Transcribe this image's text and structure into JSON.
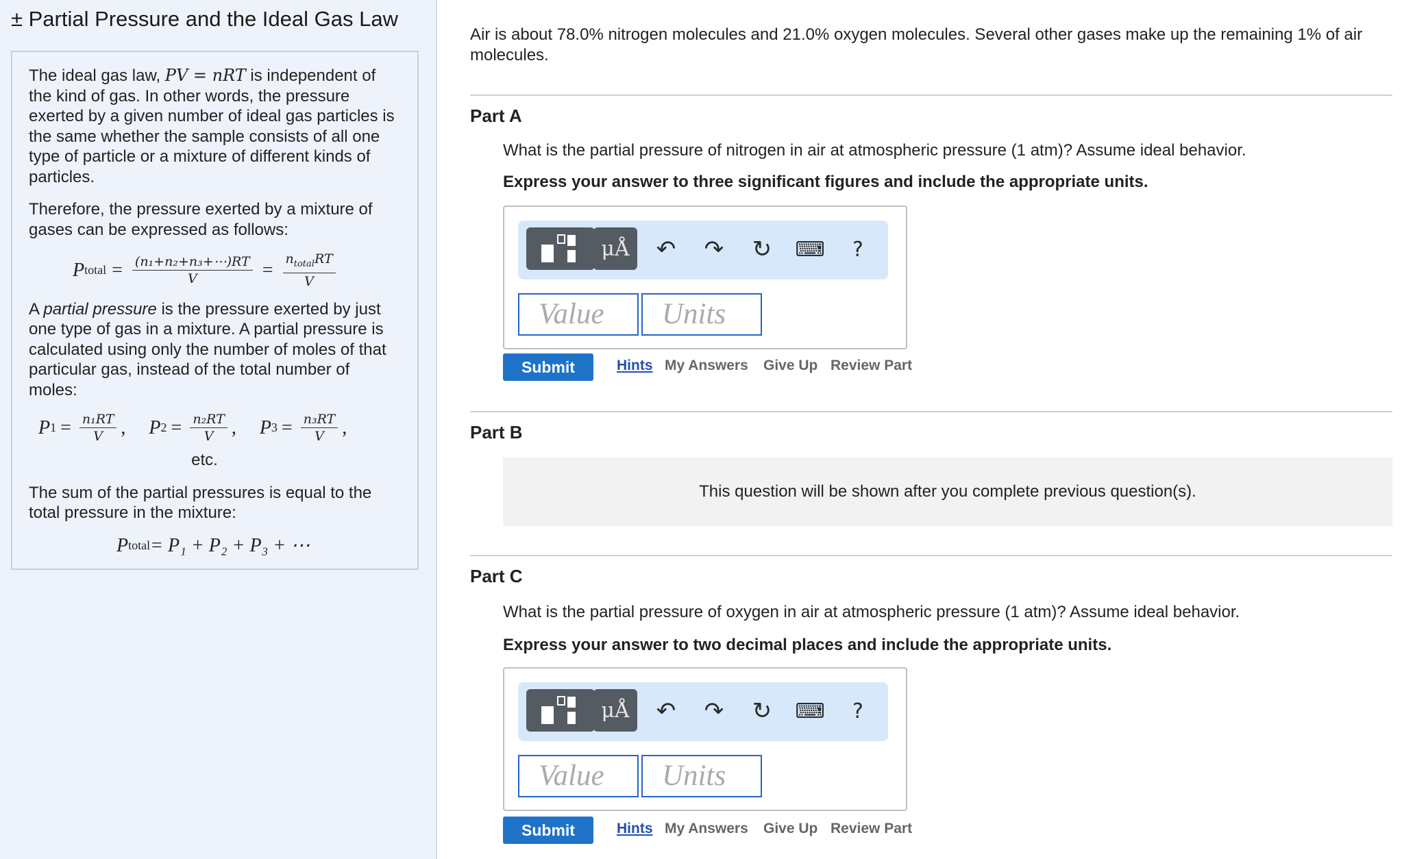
{
  "sidebar": {
    "title": "± Partial Pressure and the Ideal Gas Law",
    "para1_a": "The ideal gas law, ",
    "para1_eq": "PV = nRT",
    "para1_b": " is independent of the kind of gas. In other words, the pressure exerted by a given number of ideal gas particles is the same whether the sample consists of all one type of particle or a mixture of different kinds of particles.",
    "para2": "Therefore, the pressure exerted by a mixture of gases can be expressed as follows:",
    "eq_total": {
      "lhs": "P",
      "lhs_sub": "total",
      "frac1_num": "(n₁+n₂+n₃+⋯)RT",
      "frac1_den": "V",
      "frac2_num": "n",
      "frac2_num_sub": "total",
      "frac2_num_tail": "RT",
      "frac2_den": "V"
    },
    "para3_a": "A ",
    "para3_em": "partial pressure",
    "para3_b": " is the pressure exerted by just one type of gas in a mixture. A partial pressure is calculated using only the number of moles of that particular gas, instead of the total number of moles:",
    "eq_partials": [
      {
        "p": "P",
        "sub": "1",
        "num": "n₁RT",
        "den": "V"
      },
      {
        "p": "P",
        "sub": "2",
        "num": "n₂RT",
        "den": "V"
      },
      {
        "p": "P",
        "sub": "3",
        "num": "n₃RT",
        "den": "V"
      }
    ],
    "etc": "etc.",
    "para4": "The sum of the partial pressures is equal to the total pressure in the mixture:",
    "eq_sum": "P",
    "eq_sum_sub": "total",
    "eq_sum_rhs": " = P₁ + P₂ + P₃ + ⋯"
  },
  "main": {
    "intro": "Air is about 78.0% nitrogen molecules and 21.0% oxygen molecules. Several other gases make up the remaining 1% of air molecules.",
    "part_a": {
      "label": "Part A",
      "question": "What is the partial pressure of nitrogen in air at atmospheric pressure (1 atm)? Assume ideal behavior.",
      "instruction": "Express your answer to three significant figures and include the appropriate units."
    },
    "part_b": {
      "label": "Part B",
      "locked_text": "This question will be shown after you complete previous question(s)."
    },
    "part_c": {
      "label": "Part C",
      "question": "What is the partial pressure of oxygen in air at atmospheric pressure (1 atm)? Assume ideal behavior.",
      "instruction": "Express your answer to two decimal places and include the appropriate units."
    }
  },
  "answer_widget": {
    "units_button": "μÅ",
    "help_button": "?",
    "value_placeholder": "Value",
    "units_placeholder": "Units",
    "icons": [
      "templates-icon",
      "units-icon",
      "undo-icon",
      "redo-icon",
      "reset-icon",
      "keyboard-icon",
      "help-icon"
    ]
  },
  "actions": {
    "submit": "Submit",
    "hints": "Hints",
    "my_answers": "My Answers",
    "give_up": "Give Up",
    "review_part": "Review Part"
  }
}
